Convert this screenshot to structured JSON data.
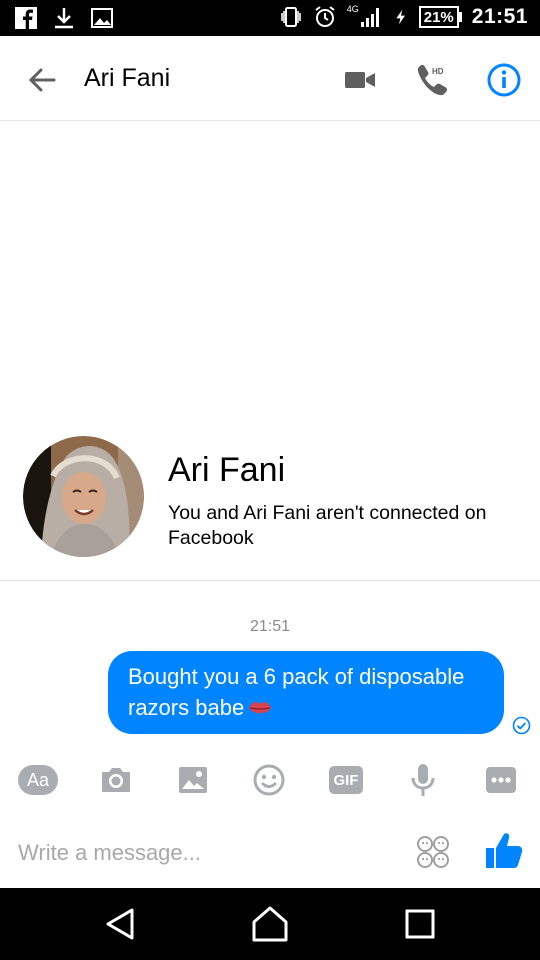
{
  "status_bar": {
    "time": "21:51",
    "battery": "21%",
    "network": "4G",
    "icons": [
      "facebook-icon",
      "download-icon",
      "image-icon",
      "vibrate-icon",
      "alarm-icon",
      "signal-icon",
      "charging-icon",
      "battery-icon"
    ]
  },
  "header": {
    "title": "Ari Fani",
    "icons": [
      "back-arrow-icon",
      "video-call-icon",
      "hd-call-icon",
      "info-icon"
    ],
    "accent_color": "#0084ff"
  },
  "profile": {
    "name": "Ari Fani",
    "note": "You and Ari Fani aren't connected on Facebook"
  },
  "conversation": {
    "timestamp": "21:51",
    "messages": [
      {
        "from": "me",
        "text": "Bought you a 6 pack of disposable razors babe",
        "emoji": "kiss-lips-icon",
        "status": "sent"
      }
    ],
    "bubble_color": "#0084ff"
  },
  "toolbar": {
    "items": [
      "text-style-icon",
      "camera-icon",
      "gallery-icon",
      "emoji-icon",
      "gif-icon",
      "microphone-icon",
      "more-icon"
    ],
    "gif_label": "GIF",
    "text_label": "Aa"
  },
  "composer": {
    "placeholder": "Write a message...",
    "value": ""
  },
  "nav_bar": {
    "icons": [
      "nav-back-icon",
      "nav-home-icon",
      "nav-recents-icon"
    ]
  }
}
